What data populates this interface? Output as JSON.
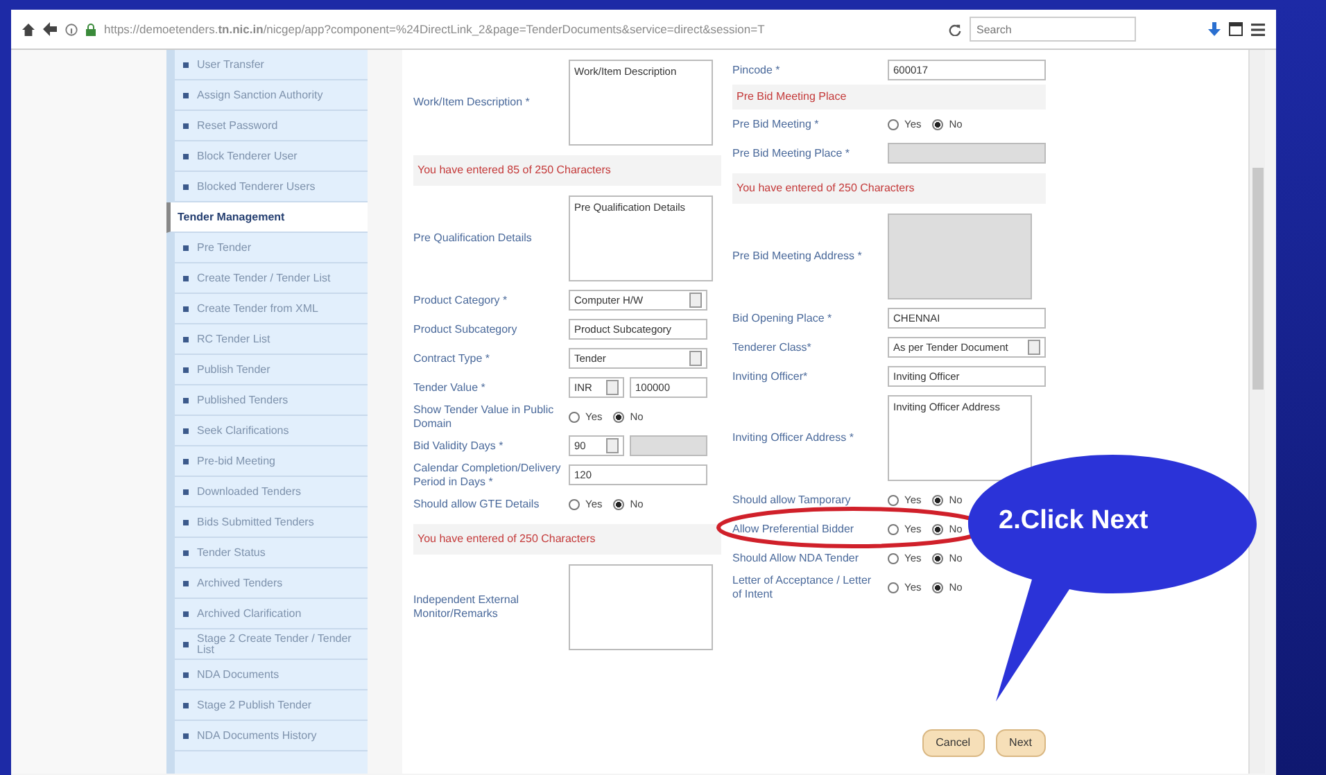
{
  "browser": {
    "url": "https://demoetenders.**tn.nic.in**/nicgep/app?component=%24DirectLink_2&page=TenderDocuments&service=direct&session=T",
    "search_placeholder": "Search"
  },
  "sidebar": {
    "items": [
      {
        "label": "User Transfer",
        "kind": "link",
        "selected": false
      },
      {
        "label": "Assign Sanction Authority",
        "kind": "link",
        "selected": false
      },
      {
        "label": "Reset Password",
        "kind": "link",
        "selected": false
      },
      {
        "label": "Block Tenderer User",
        "kind": "link",
        "selected": false
      },
      {
        "label": "Blocked Tenderer Users",
        "kind": "link",
        "selected": false
      },
      {
        "label": "Tender Management",
        "kind": "header",
        "selected": true
      },
      {
        "label": "Pre Tender",
        "kind": "link",
        "selected": false
      },
      {
        "label": "Create Tender / Tender List",
        "kind": "link",
        "selected": false
      },
      {
        "label": "Create Tender from XML",
        "kind": "link",
        "selected": false
      },
      {
        "label": "RC Tender List",
        "kind": "link",
        "selected": false
      },
      {
        "label": "Publish Tender",
        "kind": "link",
        "selected": false
      },
      {
        "label": "Published Tenders",
        "kind": "link",
        "selected": false
      },
      {
        "label": "Seek Clarifications",
        "kind": "link",
        "selected": false
      },
      {
        "label": "Pre-bid Meeting",
        "kind": "link",
        "selected": false
      },
      {
        "label": "Downloaded Tenders",
        "kind": "link",
        "selected": false
      },
      {
        "label": "Bids Submitted Tenders",
        "kind": "link",
        "selected": false
      },
      {
        "label": "Tender Status",
        "kind": "link",
        "selected": false
      },
      {
        "label": "Archived Tenders",
        "kind": "link",
        "selected": false
      },
      {
        "label": "Archived Clarification",
        "kind": "link",
        "selected": false
      },
      {
        "label": "Stage 2 Create Tender / Tender List",
        "kind": "link",
        "selected": false
      },
      {
        "label": "NDA Documents",
        "kind": "link",
        "selected": false
      },
      {
        "label": "Stage 2 Publish Tender",
        "kind": "link",
        "selected": false
      },
      {
        "label": "NDA Documents History",
        "kind": "link",
        "selected": false
      }
    ]
  },
  "form": {
    "left": [
      {
        "kind": "textarea",
        "label": "Work/Item Description *",
        "value": "Work/Item Description",
        "disabled": false
      },
      {
        "kind": "counter",
        "text": "You have entered 85 of 250 Characters"
      },
      {
        "kind": "textarea",
        "label": "Pre Qualification Details",
        "value": "Pre Qualification Details",
        "disabled": false
      },
      {
        "kind": "select",
        "label": "Product Category *",
        "value": "Computer H/W"
      },
      {
        "kind": "input",
        "label": "Product Subcategory",
        "value": "Product Subcategory",
        "disabled": false
      },
      {
        "kind": "select",
        "label": "Contract Type *",
        "value": "Tender"
      },
      {
        "kind": "money",
        "label": "Tender Value *",
        "value": "INR",
        "amount": "100000"
      },
      {
        "kind": "radio",
        "label": "Show Tender Value in Public Domain",
        "options": [
          {
            "label": "Yes",
            "selected": false
          },
          {
            "label": "No",
            "selected": true
          }
        ]
      },
      {
        "kind": "selinput",
        "label": "Bid Validity Days *",
        "value": "90"
      },
      {
        "kind": "input",
        "label": "Calendar Completion/Delivery Period in Days *",
        "value": "120",
        "disabled": false
      },
      {
        "kind": "radio",
        "label": "Should allow GTE Details",
        "options": [
          {
            "label": "Yes",
            "selected": false
          },
          {
            "label": "No",
            "selected": true
          }
        ]
      },
      {
        "kind": "counter",
        "text": "You have entered  of 250 Characters"
      },
      {
        "kind": "textarea",
        "label": "Independent External Monitor/Remarks",
        "disabled": false
      }
    ],
    "right": [
      {
        "kind": "input",
        "label": "Pincode *",
        "value": "600017",
        "disabled": false
      },
      {
        "kind": "section",
        "text": "Pre Bid Meeting Place"
      },
      {
        "kind": "radio",
        "label": "Pre Bid Meeting *",
        "options": [
          {
            "label": "Yes",
            "selected": false
          },
          {
            "label": "No",
            "selected": true
          }
        ]
      },
      {
        "kind": "input",
        "label": "Pre Bid Meeting Place *",
        "disabled": true
      },
      {
        "kind": "counter",
        "text": "You have entered  of 250 Characters"
      },
      {
        "kind": "textarea",
        "label": "Pre Bid Meeting Address *",
        "disabled": true
      },
      {
        "kind": "input",
        "label": "Bid Opening Place *",
        "value": "CHENNAI",
        "disabled": false
      },
      {
        "kind": "select",
        "label": "Tenderer Class*",
        "value": "As per Tender Document"
      },
      {
        "kind": "input",
        "label": "Inviting Officer*",
        "value": "Inviting Officer",
        "disabled": false
      },
      {
        "kind": "textarea",
        "label": "Inviting Officer Address *",
        "value": "Inviting Officer Address",
        "disabled": false
      },
      {
        "kind": "radio",
        "label": "Should allow Tamporary",
        "options": [
          {
            "label": "Yes",
            "selected": false
          },
          {
            "label": "No",
            "selected": true
          }
        ]
      },
      {
        "kind": "radio",
        "label": "Allow Preferential Bidder",
        "options": [
          {
            "label": "Yes",
            "selected": false
          },
          {
            "label": "No",
            "selected": true
          }
        ]
      },
      {
        "kind": "radio",
        "label": "Should Allow NDA Tender",
        "options": [
          {
            "label": "Yes",
            "selected": false
          },
          {
            "label": "No",
            "selected": true
          }
        ]
      },
      {
        "kind": "radio",
        "label": "Letter of Acceptance / Letter of Intent",
        "options": [
          {
            "label": "Yes",
            "selected": false
          },
          {
            "label": "No",
            "selected": true
          }
        ]
      }
    ]
  },
  "buttons": [
    {
      "label": "Cancel"
    },
    {
      "label": "Next"
    }
  ],
  "callout": {
    "text": "2.Click Next"
  }
}
